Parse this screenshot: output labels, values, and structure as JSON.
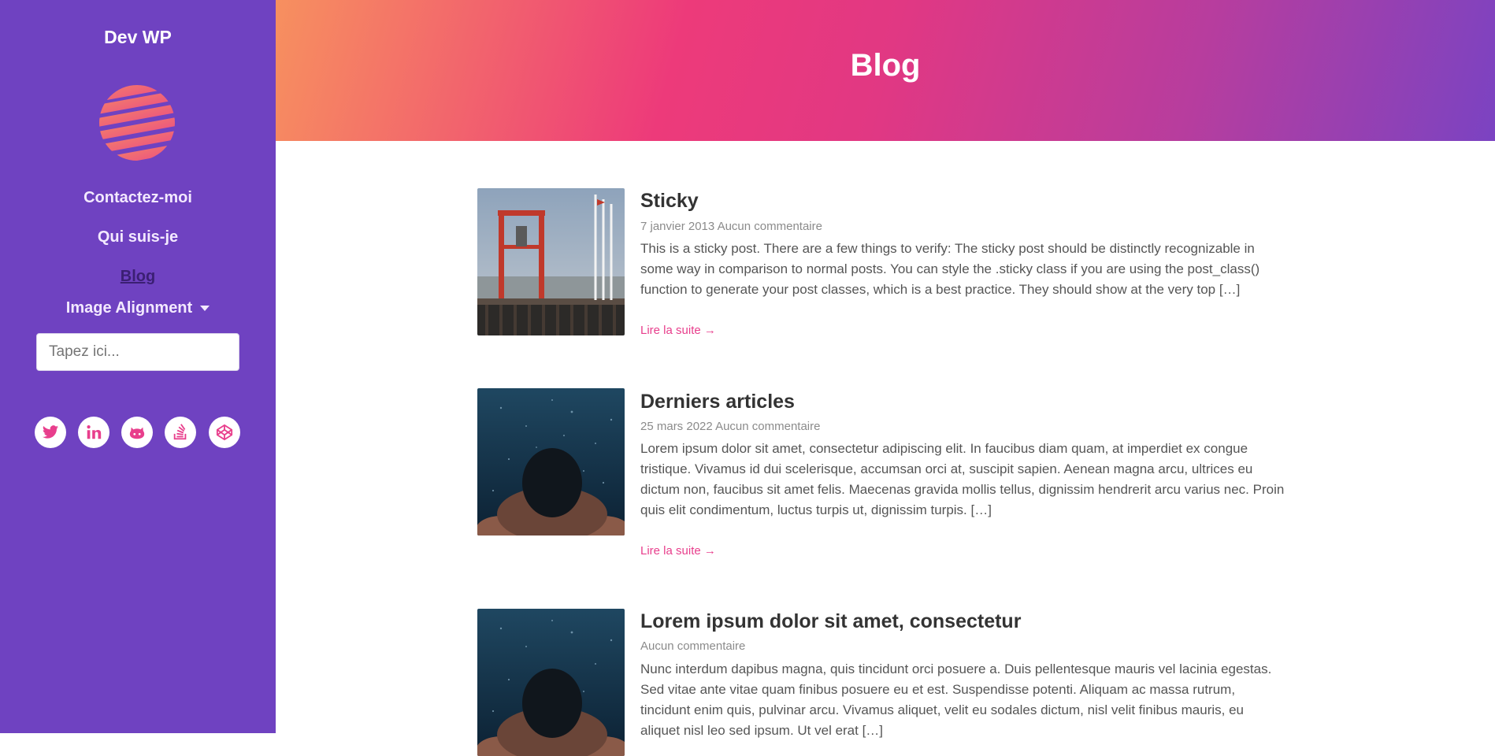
{
  "sidebar": {
    "site_title": "Dev WP",
    "logo": "globe-logo",
    "nav": [
      {
        "label": "Contactez-moi",
        "active": false
      },
      {
        "label": "Qui suis-je",
        "active": false
      },
      {
        "label": "Blog",
        "active": true
      },
      {
        "label": "Image Alignment",
        "dropdown": true
      }
    ],
    "search": {
      "placeholder": "Tapez ici...",
      "value": ""
    },
    "social": [
      "twitter-icon",
      "linkedin-icon",
      "github-icon",
      "stackoverflow-icon",
      "codepen-icon"
    ],
    "colors": {
      "background": "#6f42c1",
      "icon": "#e83e8c"
    }
  },
  "header": {
    "title": "Blog",
    "gradient": [
      "#f7905f",
      "#ed3a7a",
      "#7b43c2"
    ]
  },
  "posts": [
    {
      "title": "Sticky",
      "date": "7 janvier 2013",
      "comments": "Aucun commentaire",
      "excerpt": "This is a sticky post. There are a few things to verify: The sticky post should be distinctly recognizable in some way in comparison to normal posts. You can style the .sticky class if you are using the post_class() function to generate your post classes, which is a best practice. They should show at the very top […]",
      "read_more": "Lire la suite →",
      "image": "pier-tower-photo"
    },
    {
      "title": "Derniers articles",
      "date": "25 mars 2022",
      "comments": "Aucun commentaire",
      "excerpt": "Lorem ipsum dolor sit amet, consectetur adipiscing elit. In faucibus diam quam, at imperdiet ex congue tristique. Vivamus id dui scelerisque, accumsan orci at, suscipit sapien. Aenean magna arcu, ultrices eu dictum non, faucibus sit amet felis. Maecenas gravida mollis tellus, dignissim hendrerit arcu varius nec. Proin quis elit condimentum, luctus turpis ut, dignissim turpis. […]",
      "read_more": "Lire la suite →",
      "image": "underwater-swimmer-photo"
    },
    {
      "title": "Lorem ipsum dolor sit amet, consectetur",
      "date": "",
      "comments": "Aucun commentaire",
      "excerpt": "Nunc interdum dapibus magna, quis tincidunt orci posuere a. Duis pellentesque mauris vel lacinia egestas. Sed vitae ante vitae quam finibus posuere eu et est. Suspendisse potenti. Aliquam ac massa rutrum, tincidunt enim quis, pulvinar arcu. Vivamus aliquet, velit eu sodales dictum, nisl velit finibus mauris, eu aliquet nisl leo sed ipsum. Ut vel erat […]",
      "image": "underwater-swimmer-photo"
    }
  ]
}
